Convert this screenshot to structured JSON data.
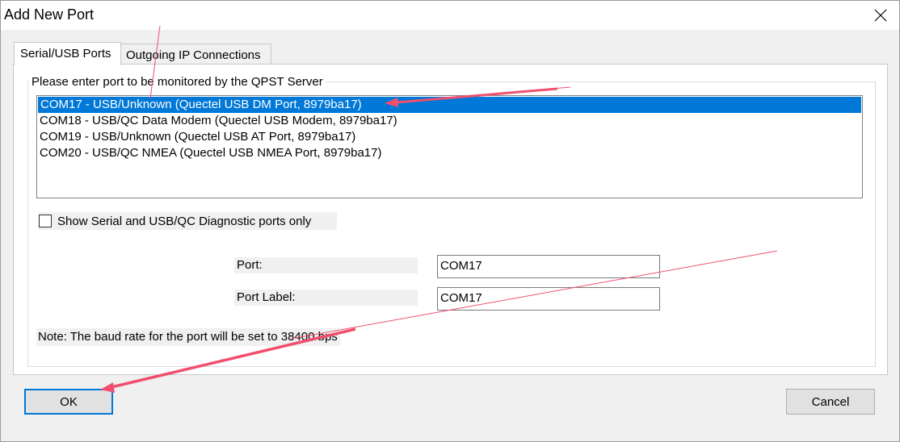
{
  "window": {
    "title": "Add New Port",
    "close_icon": "close-icon"
  },
  "tabs": [
    {
      "label": "Serial/USB Ports",
      "active": true
    },
    {
      "label": "Outgoing IP Connections",
      "active": false
    }
  ],
  "group": {
    "legend": "Please enter port to be monitored by the QPST Server"
  },
  "ports": [
    {
      "label": "COM17 - USB/Unknown (Quectel USB DM Port, 8979ba17)",
      "selected": true
    },
    {
      "label": "COM18 - USB/QC Data Modem (Quectel USB Modem, 8979ba17)",
      "selected": false
    },
    {
      "label": "COM19 - USB/Unknown (Quectel USB AT Port, 8979ba17)",
      "selected": false
    },
    {
      "label": "COM20 - USB/QC NMEA (Quectel USB NMEA Port, 8979ba17)",
      "selected": false
    }
  ],
  "filter": {
    "label": "Show Serial and USB/QC Diagnostic ports only",
    "checked": false
  },
  "fields": {
    "port_label": "Port:",
    "port_value": "COM17",
    "port_label_label": "Port Label:",
    "port_label_value": "COM17"
  },
  "note": "Note: The baud rate for the port will be set to 38400 bps",
  "buttons": {
    "ok": "OK",
    "cancel": "Cancel"
  },
  "colors": {
    "selection": "#0078d7",
    "annotation_arrow": "#f0506e"
  }
}
